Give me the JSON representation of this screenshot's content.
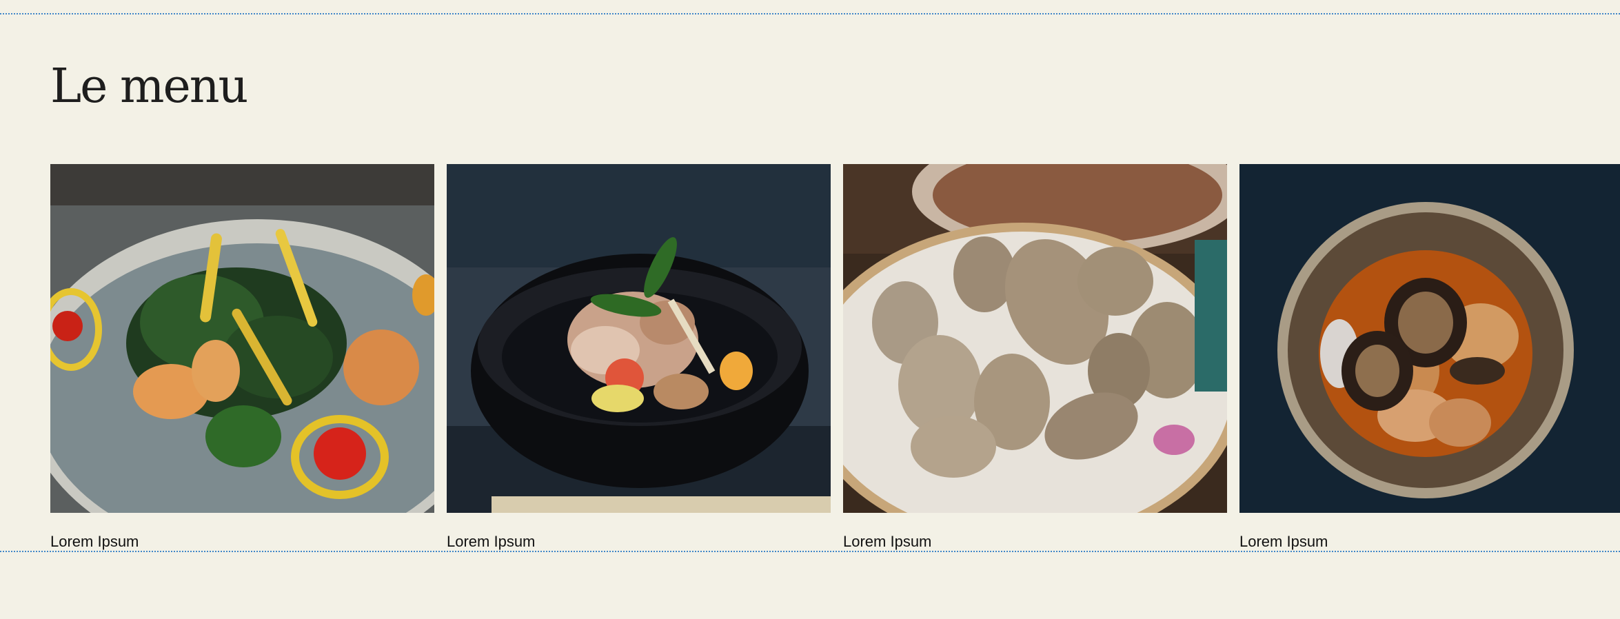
{
  "section": {
    "title": "Le menu"
  },
  "dishes": [
    {
      "name": "Lorem Ipsum",
      "image": "shrimp-salad-photo"
    },
    {
      "name": "Lorem Ipsum",
      "image": "fish-bowl-photo"
    },
    {
      "name": "Lorem Ipsum",
      "image": "sea-snails-photo"
    },
    {
      "name": "Lorem Ipsum",
      "image": "braised-eggplant-photo"
    }
  ]
}
